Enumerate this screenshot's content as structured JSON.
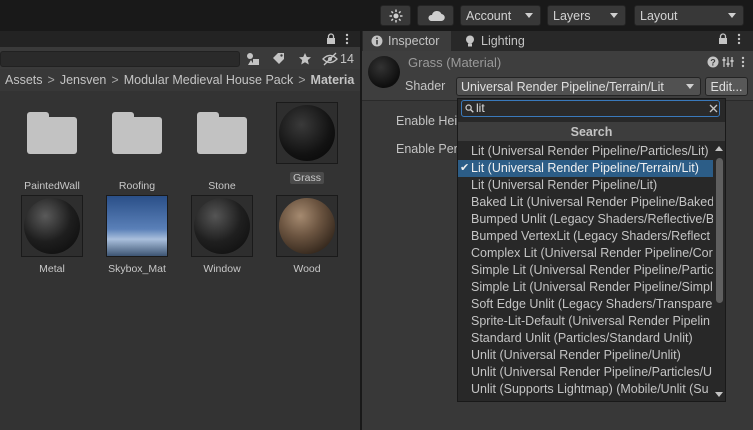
{
  "toolbar": {
    "account_label": "Account",
    "layers_label": "Layers",
    "layout_label": "Layout"
  },
  "project": {
    "visibility_count": "14",
    "breadcrumb": [
      "Assets",
      "Jensven",
      "Modular Medieval House Pack",
      "Materia"
    ],
    "assets": [
      {
        "name": "PaintedWall",
        "kind": "folder"
      },
      {
        "name": "Roofing",
        "kind": "folder"
      },
      {
        "name": "Stone",
        "kind": "folder"
      },
      {
        "name": "Grass",
        "kind": "material",
        "selected": true
      },
      {
        "name": "Metal",
        "kind": "material"
      },
      {
        "name": "Skybox_Mat",
        "kind": "skybox"
      },
      {
        "name": "Window",
        "kind": "material"
      },
      {
        "name": "Wood",
        "kind": "material"
      }
    ]
  },
  "inspector": {
    "tabs": [
      {
        "label": "Inspector",
        "icon": "info-icon"
      },
      {
        "label": "Lighting",
        "icon": "bulb-icon"
      }
    ],
    "title": "Grass (Material)",
    "shader_label": "Shader",
    "shader_value": "Universal Render Pipeline/Terrain/Lit",
    "edit_label": "Edit...",
    "props": [
      "Enable Hei",
      "Enable Per"
    ]
  },
  "dropdown": {
    "search_value": "lit",
    "header": "Search",
    "items": [
      "Lit (Universal Render Pipeline/Particles/Lit)",
      "Lit (Universal Render Pipeline/Terrain/Lit)",
      "Lit (Universal Render Pipeline/Lit)",
      "Baked Lit (Universal Render Pipeline/Baked",
      "Bumped Unlit (Legacy Shaders/Reflective/B",
      "Bumped VertexLit (Legacy Shaders/Reflect",
      "Complex Lit (Universal Render Pipeline/Cor",
      "Simple Lit (Universal Render Pipeline/Partic",
      "Simple Lit (Universal Render Pipeline/Simpl",
      "Soft Edge Unlit (Legacy Shaders/Transpare",
      "Sprite-Lit-Default (Universal Render Pipelin",
      "Standard Unlit (Particles/Standard Unlit)",
      "Unlit (Universal Render Pipeline/Unlit)",
      "Unlit (Universal Render Pipeline/Particles/U",
      "Unlit (Supports Lightmap) (Mobile/Unlit (Su"
    ],
    "selected_index": 1,
    "check_mark": "✔"
  },
  "colors": {
    "selection": "#2c5d87",
    "focus_border": "#3a79bb"
  }
}
